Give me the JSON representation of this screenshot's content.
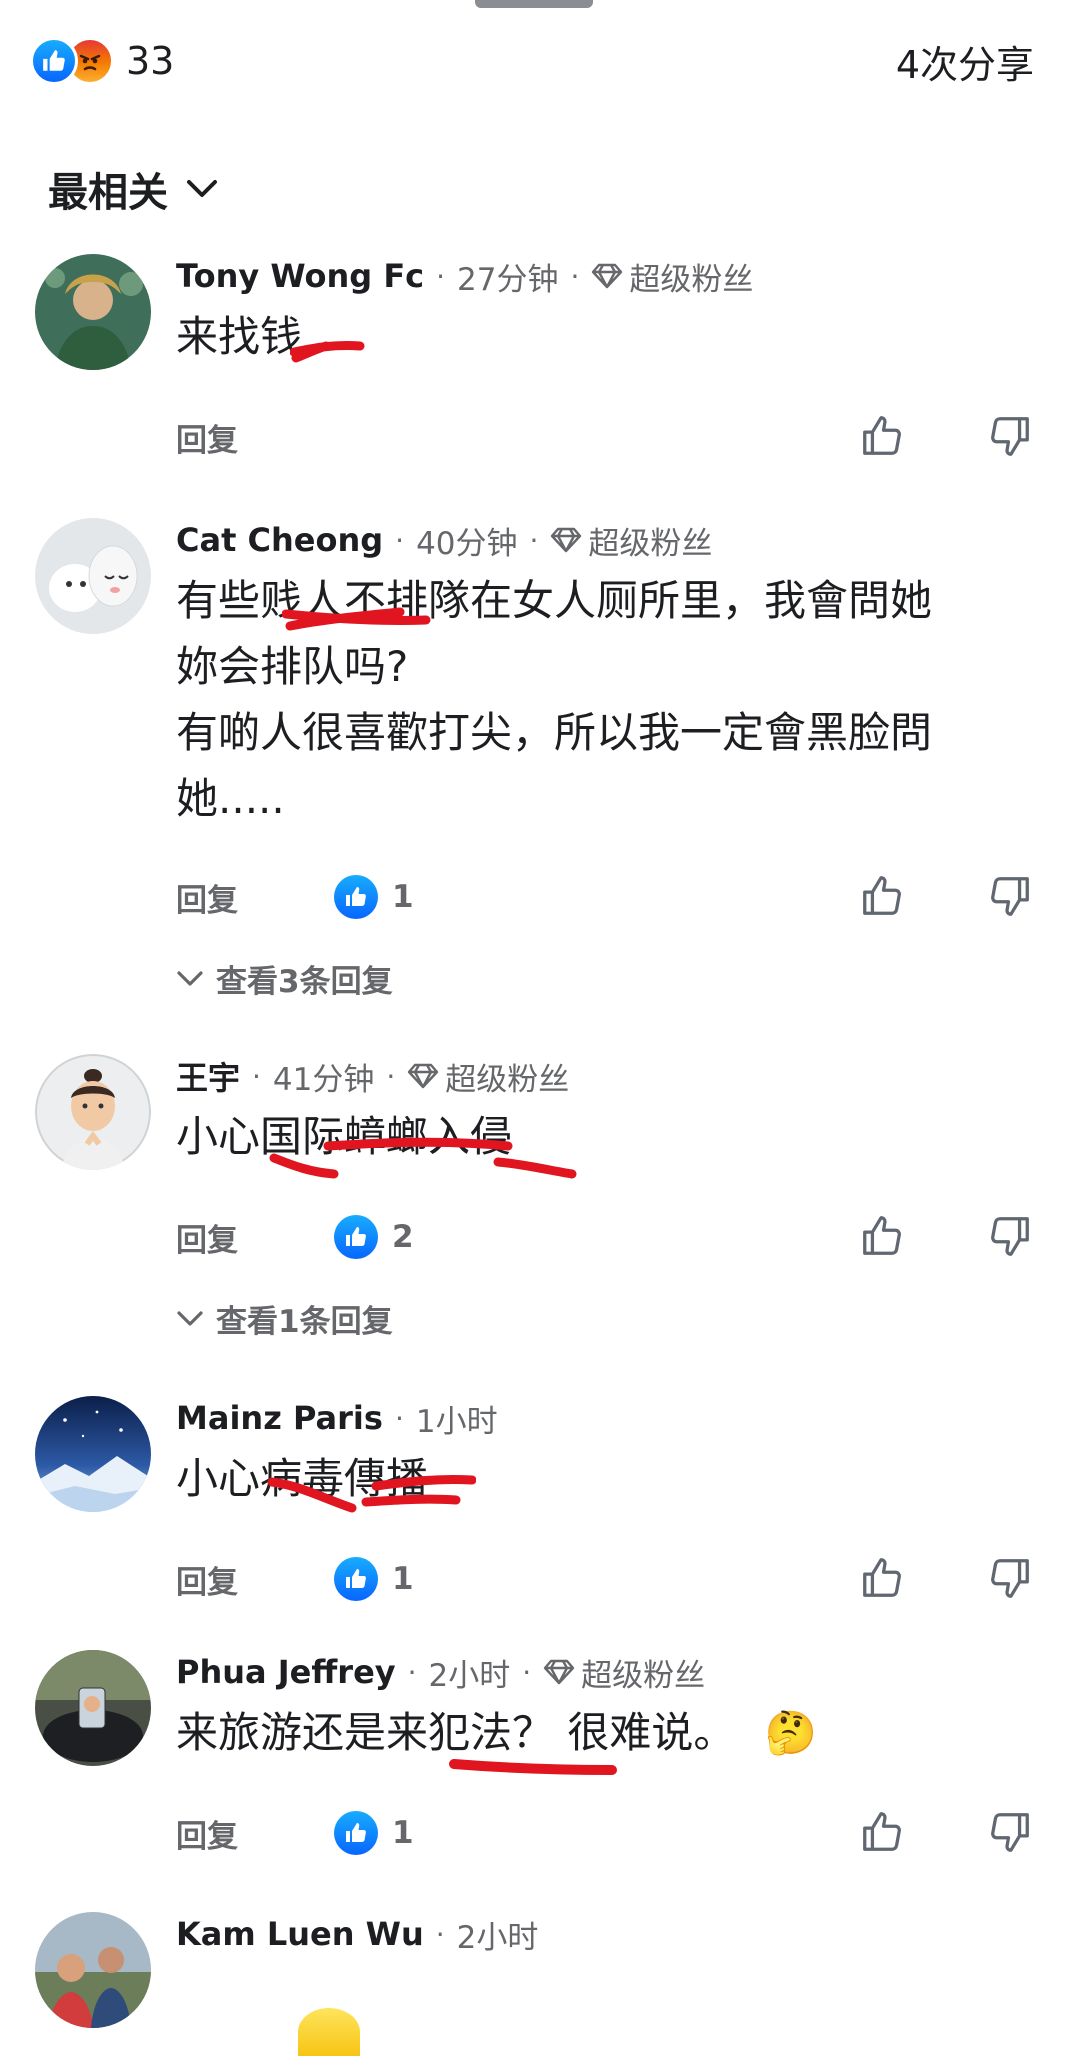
{
  "header": {
    "reaction_count": "33",
    "shares": "4次分享",
    "reaction_icons": [
      "like-icon",
      "angry-icon"
    ]
  },
  "sort": {
    "label": "最相关"
  },
  "common": {
    "reply_label": "回复",
    "dot": "·",
    "super_fan": "超级粉丝"
  },
  "comments": [
    {
      "name": "Tony Wong Fc",
      "time": "27分钟",
      "badge": "超级粉丝",
      "text": "来找钱",
      "likes": "",
      "view_replies": ""
    },
    {
      "name": "Cat Cheong",
      "time": "40分钟",
      "badge": "超级粉丝",
      "text": "有些贱人不排隊在女人厕所里，我會問她\n妳会排队吗?\n有啲人很喜歡打尖，所以我一定會黑脸問\n她.....",
      "likes": "1",
      "view_replies": "查看3条回复"
    },
    {
      "name": "王宇",
      "time": "41分钟",
      "badge": "超级粉丝",
      "text": "小心国际蟑螂入侵",
      "likes": "2",
      "view_replies": "查看1条回复"
    },
    {
      "name": "Mainz Paris",
      "time": "1小时",
      "badge": "",
      "text": "小心病毒傳播",
      "likes": "1",
      "view_replies": ""
    },
    {
      "name": "Phua Jeffrey",
      "time": "2小时",
      "badge": "超级粉丝",
      "text": "来旅游还是来犯法？ 很难说。",
      "emoji": "🤔",
      "likes": "1",
      "view_replies": ""
    },
    {
      "name": "Kam Luen Wu",
      "time": "2小时",
      "badge": "",
      "text": "",
      "likes": "",
      "view_replies": ""
    }
  ],
  "colors": {
    "like_blue": "#0866ff",
    "secondary_text": "#65676b",
    "scribble_red": "#e0151f"
  }
}
